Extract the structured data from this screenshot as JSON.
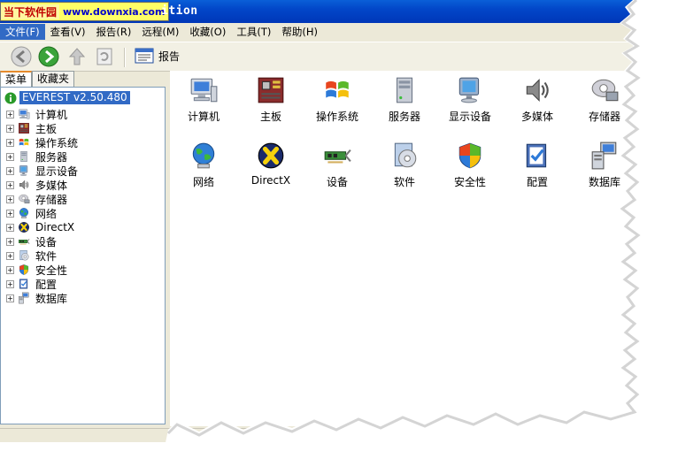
{
  "window": {
    "title": "ition",
    "watermark": {
      "name": "当下软件园",
      "url": "www.downxia.com"
    }
  },
  "menubar": {
    "items": [
      {
        "label": "文件(F)",
        "active": true
      },
      {
        "label": "查看(V)"
      },
      {
        "label": "报告(R)"
      },
      {
        "label": "远程(M)"
      },
      {
        "label": "收藏(O)"
      },
      {
        "label": "工具(T)"
      },
      {
        "label": "帮助(H)"
      }
    ]
  },
  "toolbar": {
    "back_icon": "back-arrow-icon",
    "forward_icon": "forward-arrow-icon",
    "up_icon": "up-arrow-icon",
    "refresh_icon": "refresh-icon",
    "report_label": "报告"
  },
  "left_panel": {
    "tabs": [
      {
        "label": "菜单",
        "selected": true
      },
      {
        "label": "收藏夹"
      }
    ],
    "root": "EVEREST v2.50.480",
    "items": [
      {
        "label": "计算机",
        "icon": "computer-icon"
      },
      {
        "label": "主板",
        "icon": "motherboard-icon"
      },
      {
        "label": "操作系统",
        "icon": "windows-icon"
      },
      {
        "label": "服务器",
        "icon": "server-icon"
      },
      {
        "label": "显示设备",
        "icon": "display-icon"
      },
      {
        "label": "多媒体",
        "icon": "speaker-icon"
      },
      {
        "label": "存储器",
        "icon": "storage-icon"
      },
      {
        "label": "网络",
        "icon": "network-icon"
      },
      {
        "label": "DirectX",
        "icon": "directx-icon"
      },
      {
        "label": "设备",
        "icon": "devices-icon"
      },
      {
        "label": "软件",
        "icon": "software-icon"
      },
      {
        "label": "安全性",
        "icon": "security-icon"
      },
      {
        "label": "配置",
        "icon": "config-icon"
      },
      {
        "label": "数据库",
        "icon": "database-icon"
      }
    ]
  },
  "main": {
    "icons": [
      {
        "label": "计算机",
        "icon": "computer-icon"
      },
      {
        "label": "主板",
        "icon": "motherboard-icon"
      },
      {
        "label": "操作系统",
        "icon": "windows-icon"
      },
      {
        "label": "服务器",
        "icon": "server-icon"
      },
      {
        "label": "显示设备",
        "icon": "display-icon"
      },
      {
        "label": "多媒体",
        "icon": "speaker-icon"
      },
      {
        "label": "存储器",
        "icon": "storage-icon"
      },
      {
        "label": "网络",
        "icon": "network-icon"
      },
      {
        "label": "DirectX",
        "icon": "directx-icon"
      },
      {
        "label": "设备",
        "icon": "devices-icon"
      },
      {
        "label": "软件",
        "icon": "software-icon"
      },
      {
        "label": "安全性",
        "icon": "security-icon"
      },
      {
        "label": "配置",
        "icon": "config-icon"
      },
      {
        "label": "数据库",
        "icon": "database-icon"
      }
    ]
  },
  "colors": {
    "titlebar": "#0246c8",
    "selection": "#316ac5",
    "chrome": "#ece9d8"
  }
}
